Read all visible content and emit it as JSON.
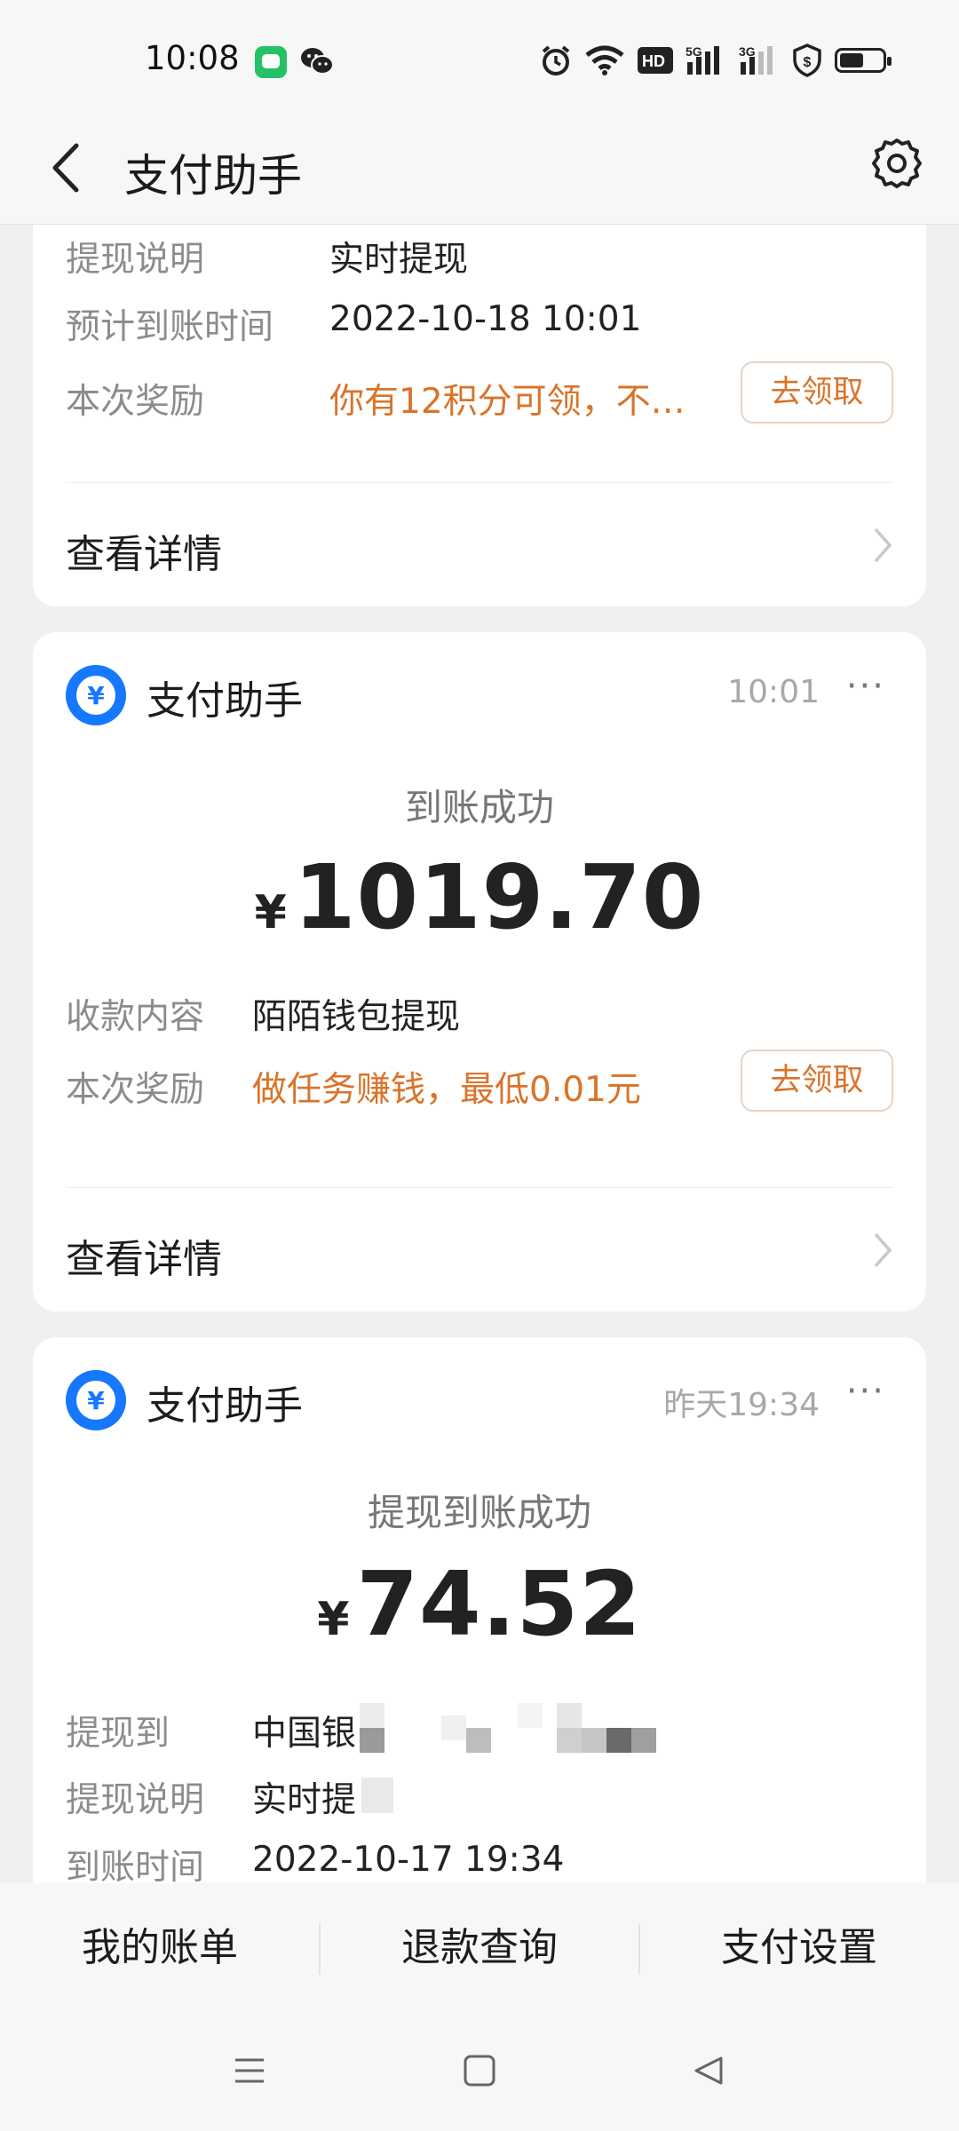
{
  "status_bar": {
    "time": "10:08",
    "icons": [
      "messages-icon",
      "wechat-icon",
      "alarm-icon",
      "wifi-icon",
      "hd-icon",
      "signal-5g-icon",
      "signal-3g-icon",
      "shield-dollar-icon",
      "battery-icon"
    ],
    "hd_text": "HD",
    "sig1_text": "5G",
    "sig2_text": "3G"
  },
  "nav": {
    "title": "支付助手"
  },
  "card1": {
    "rows": [
      {
        "label": "提现说明",
        "value": "实时提现"
      },
      {
        "label": "预计到账时间",
        "value": "2022-10-18 10:01"
      },
      {
        "label": "本次奖励",
        "value": "你有12积分可领，不…"
      }
    ],
    "claim_label": "去领取",
    "detail_label": "查看详情"
  },
  "card2": {
    "sender": "支付助手",
    "time": "10:01",
    "more": "···",
    "status": "到账成功",
    "currency": "¥",
    "amount": "1019.70",
    "rows": [
      {
        "label": "收款内容",
        "value": "陌陌钱包提现"
      },
      {
        "label": "本次奖励",
        "value": "做任务赚钱，最低0.01元"
      }
    ],
    "claim_label": "去领取",
    "detail_label": "查看详情"
  },
  "card3": {
    "sender": "支付助手",
    "time": "昨天19:34",
    "more": "···",
    "status": "提现到账成功",
    "currency": "¥",
    "amount": "74.52",
    "rows": [
      {
        "label": "提现到",
        "value": "中国银"
      },
      {
        "label": "提现说明",
        "value": "实时提"
      },
      {
        "label": "到账时间",
        "value": "2022-10-17 19:34"
      }
    ]
  },
  "bottom_tabs": [
    "我的账单",
    "退款查询",
    "支付设置"
  ],
  "colors": {
    "accent_orange": "#d9742a",
    "logo_blue": "#1677ff",
    "background": "#f0f0f0",
    "card": "#ffffff"
  }
}
